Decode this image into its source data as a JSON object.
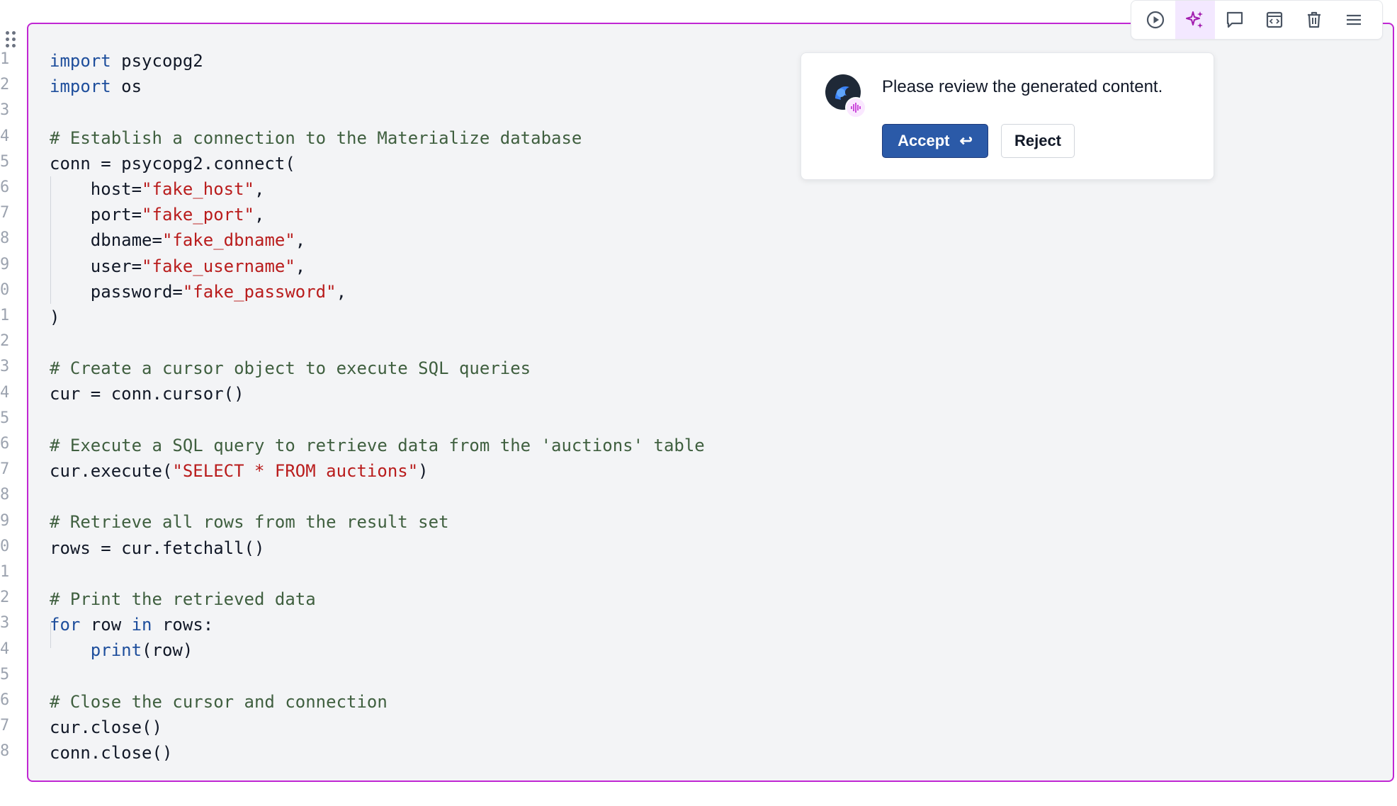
{
  "editor": {
    "line_numbers": [
      "1",
      "2",
      "3",
      "4",
      "5",
      "6",
      "7",
      "8",
      "9",
      "0",
      "1",
      "2",
      "3",
      "4",
      "5",
      "6",
      "7",
      "8",
      "9",
      "0",
      "1",
      "2",
      "3",
      "4",
      "5",
      "6",
      "7",
      "8"
    ],
    "lines": [
      [
        {
          "t": "import",
          "c": "kw"
        },
        {
          "t": " psycopg2",
          "c": ""
        }
      ],
      [
        {
          "t": "import",
          "c": "kw"
        },
        {
          "t": " os",
          "c": ""
        }
      ],
      [],
      [
        {
          "t": "# Establish a connection to the Materialize database",
          "c": "com"
        }
      ],
      [
        {
          "t": "conn = psycopg2.connect(",
          "c": ""
        }
      ],
      [
        {
          "t": "    host=",
          "c": ""
        },
        {
          "t": "\"fake_host\"",
          "c": "str"
        },
        {
          "t": ",",
          "c": ""
        }
      ],
      [
        {
          "t": "    port=",
          "c": ""
        },
        {
          "t": "\"fake_port\"",
          "c": "str"
        },
        {
          "t": ",",
          "c": ""
        }
      ],
      [
        {
          "t": "    dbname=",
          "c": ""
        },
        {
          "t": "\"fake_dbname\"",
          "c": "str"
        },
        {
          "t": ",",
          "c": ""
        }
      ],
      [
        {
          "t": "    user=",
          "c": ""
        },
        {
          "t": "\"fake_username\"",
          "c": "str"
        },
        {
          "t": ",",
          "c": ""
        }
      ],
      [
        {
          "t": "    password=",
          "c": ""
        },
        {
          "t": "\"fake_password\"",
          "c": "str"
        },
        {
          "t": ",",
          "c": ""
        }
      ],
      [
        {
          "t": ")",
          "c": ""
        }
      ],
      [],
      [
        {
          "t": "# Create a cursor object to execute SQL queries",
          "c": "com"
        }
      ],
      [
        {
          "t": "cur = conn.cursor()",
          "c": ""
        }
      ],
      [],
      [
        {
          "t": "# Execute a SQL query to retrieve data from the 'auctions' table",
          "c": "com"
        }
      ],
      [
        {
          "t": "cur.execute(",
          "c": ""
        },
        {
          "t": "\"SELECT * FROM auctions\"",
          "c": "str"
        },
        {
          "t": ")",
          "c": ""
        }
      ],
      [],
      [
        {
          "t": "# Retrieve all rows from the result set",
          "c": "com"
        }
      ],
      [
        {
          "t": "rows = cur.fetchall()",
          "c": ""
        }
      ],
      [],
      [
        {
          "t": "# Print the retrieved data",
          "c": "com"
        }
      ],
      [
        {
          "t": "for",
          "c": "kw"
        },
        {
          "t": " row ",
          "c": ""
        },
        {
          "t": "in",
          "c": "kw"
        },
        {
          "t": " rows:",
          "c": ""
        }
      ],
      [
        {
          "t": "    ",
          "c": ""
        },
        {
          "t": "print",
          "c": "fn"
        },
        {
          "t": "(row)",
          "c": ""
        }
      ],
      [],
      [
        {
          "t": "# Close the cursor and connection",
          "c": "com"
        }
      ],
      [
        {
          "t": "cur.close()",
          "c": ""
        }
      ],
      [
        {
          "t": "conn.close()",
          "c": ""
        }
      ]
    ]
  },
  "toolbar": {
    "items": [
      {
        "name": "run-icon",
        "active": false
      },
      {
        "name": "ai-sparkle-icon",
        "active": true
      },
      {
        "name": "comment-icon",
        "active": false
      },
      {
        "name": "code-block-icon",
        "active": false
      },
      {
        "name": "trash-icon",
        "active": false
      },
      {
        "name": "menu-icon",
        "active": false
      }
    ]
  },
  "review": {
    "message": "Please review the generated content.",
    "accept_label": "Accept",
    "accept_shortcut": "↩",
    "reject_label": "Reject"
  },
  "colors": {
    "accent": "#c026d3",
    "primary_button": "#2b5aa8",
    "keyword": "#1e4e9c",
    "string": "#b91c1c",
    "comment": "#3f5f3f"
  }
}
